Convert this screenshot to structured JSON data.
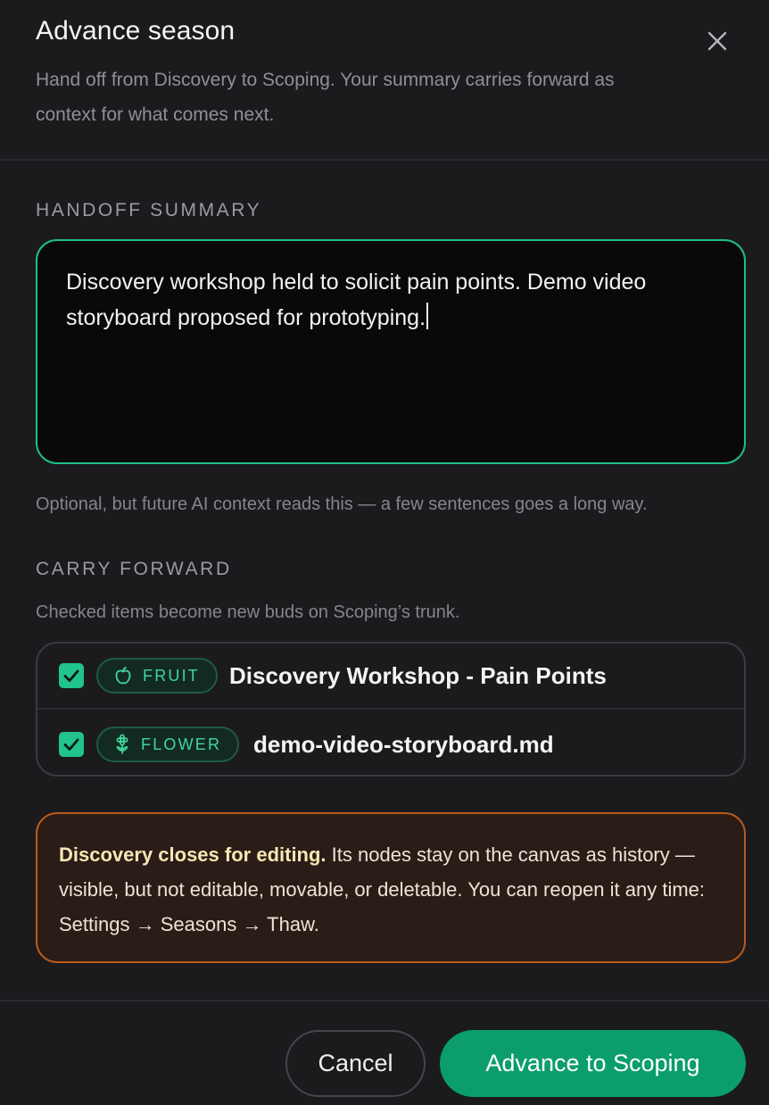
{
  "dialog": {
    "title": "Advance season",
    "close_icon": "close-icon",
    "subtitle": "Hand off from Discovery to Scoping. Your summary carries forward as context for what comes next."
  },
  "handoff": {
    "label": "HANDOFF SUMMARY",
    "value": "Discovery workshop held to solicit pain points. Demo video storyboard proposed for prototyping.",
    "hint": "Optional, but future AI context reads this — a few sentences goes a long way."
  },
  "carry_forward": {
    "label": "CARRY FORWARD",
    "hint": "Checked items become new buds on Scoping’s trunk.",
    "items": [
      {
        "checked": true,
        "badge_icon": "apple-icon",
        "badge": "FRUIT",
        "title": "Discovery Workshop - Pain Points"
      },
      {
        "checked": true,
        "badge_icon": "flower-icon",
        "badge": "FLOWER",
        "title": "demo-video-storyboard.md"
      }
    ]
  },
  "warning": {
    "bold": "Discovery closes for editing.",
    "text": " Its nodes stay on the canvas as history — visible, but not editable, movable, or deletable. You can reopen it any time: Settings → Seasons → Thaw."
  },
  "footer": {
    "cancel_label": "Cancel",
    "primary_label": "Advance to Scoping"
  },
  "colors": {
    "accent": "#0b9e6c",
    "focus_border": "#1fbf86",
    "warning_border": "#b85a1c",
    "background": "#1b1b1e"
  }
}
